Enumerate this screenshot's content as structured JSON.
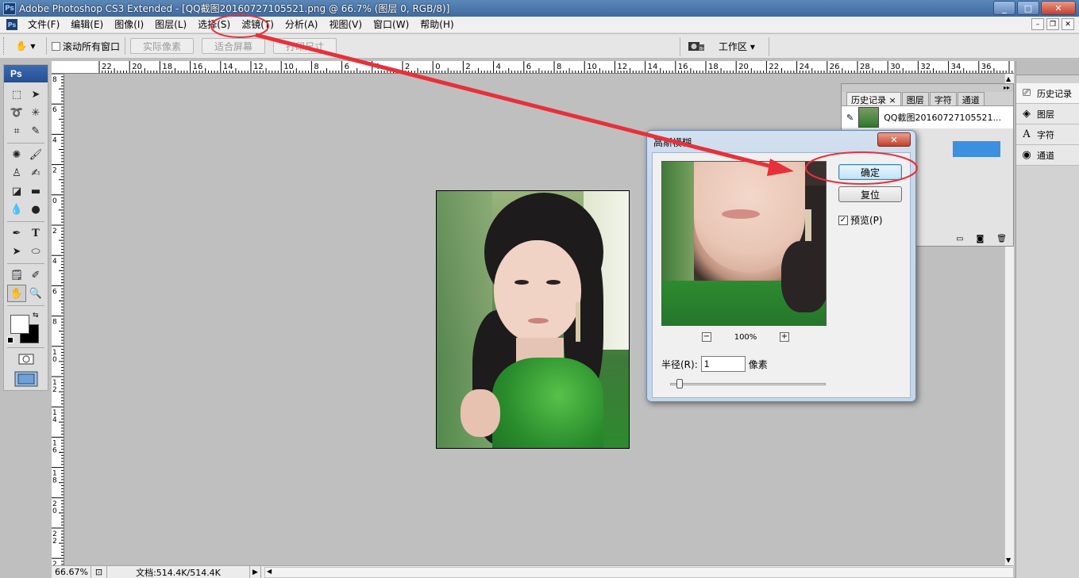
{
  "window": {
    "title": "Adobe Photoshop CS3 Extended - [QQ截图20160727105521.png @ 66.7% (图层 0, RGB/8)]",
    "minimize": "_",
    "maximize": "□",
    "close": "✕"
  },
  "menu": {
    "items": [
      "文件(F)",
      "编辑(E)",
      "图像(I)",
      "图层(L)",
      "选择(S)",
      "滤镜(T)",
      "分析(A)",
      "视图(V)",
      "窗口(W)",
      "帮助(H)"
    ]
  },
  "options": {
    "scroll_all_label": "滚动所有窗口",
    "actual_pixels": "实际像素",
    "fit_screen": "适合屏幕",
    "print_size": "打印尺寸",
    "workspace": "工作区 ▾"
  },
  "toolbox": {
    "logo": "Ps"
  },
  "rulers": {
    "top": [
      "22",
      "20",
      "18",
      "16",
      "14",
      "12",
      "10",
      "8",
      "6",
      "4",
      "2",
      "0",
      "2",
      "4",
      "6",
      "8",
      "10",
      "12",
      "14",
      "16",
      "18",
      "20",
      "22",
      "24",
      "26",
      "28",
      "30",
      "32",
      "34",
      "36"
    ],
    "left": [
      "8",
      "6",
      "4",
      "2",
      "0",
      "2",
      "4",
      "6",
      "8",
      "10",
      "12",
      "14",
      "16",
      "18",
      "20",
      "22",
      "2"
    ]
  },
  "status": {
    "zoom": "66.67%",
    "doc": "文档:514.4K/514.4K"
  },
  "dock": {
    "items": [
      {
        "label": "历史记录",
        "icon": "history-icon"
      },
      {
        "label": "图层",
        "icon": "layers-icon"
      },
      {
        "label": "字符",
        "icon": "character-icon"
      },
      {
        "label": "通道",
        "icon": "channels-icon"
      }
    ]
  },
  "history_panel": {
    "tabs": [
      "历史记录",
      "图层",
      "字符",
      "通道"
    ],
    "snapshot_name": "QQ截图20160727105521..."
  },
  "dialog": {
    "title": "高斯模糊",
    "ok": "确定",
    "reset": "复位",
    "preview_label": "预览(P)",
    "preview_checked": "✓",
    "zoom_value": "100%",
    "radius_label": "半径(R):",
    "radius_value": "1",
    "radius_unit": "像素"
  },
  "colors": {
    "annotation": "#e8303a",
    "selection_blue": "#3d8fe0"
  }
}
